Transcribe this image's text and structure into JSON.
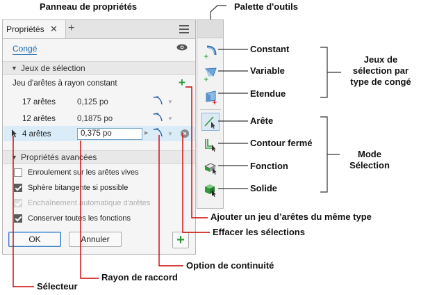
{
  "annotations": {
    "panel_title": "Panneau de propriétés",
    "palette_title": "Palette d'outils",
    "constant": "Constant",
    "variable": "Variable",
    "etendue": "Etendue",
    "jeux_group": "Jeux de sélection par type de congé",
    "arete": "Arête",
    "contour": "Contour fermé",
    "fonction": "Fonction",
    "solide": "Solide",
    "mode_group": "Mode Sélection",
    "add_set": "Ajouter un jeu d’arêtes du même type",
    "clear": "Effacer les sélections",
    "continuity": "Option de continuité",
    "radius": "Rayon de raccord",
    "selector": "Sélecteur"
  },
  "panel": {
    "tab_label": "Propriétés",
    "close_glyph": "✕",
    "add_glyph": "+",
    "feature_name": "Congé",
    "selection_sets": {
      "header": "Jeux de sélection",
      "subheader": "Jeu d'arêtes à rayon constant",
      "rows": [
        {
          "edges": "17 arêtes",
          "radius": "0,125 po"
        },
        {
          "edges": "12 arêtes",
          "radius": "0,1875 po"
        },
        {
          "edges": "4 arêtes",
          "radius": "0,375 po"
        }
      ]
    },
    "advanced": {
      "header": "Propriétés avancées",
      "options": [
        {
          "label": "Enroulement sur les arêtes vives",
          "checked": false,
          "disabled": false
        },
        {
          "label": "Sphère bitangente si possible",
          "checked": true,
          "disabled": false
        },
        {
          "label": "Enchaînement automatique d'arêtes",
          "checked": true,
          "disabled": true
        },
        {
          "label": "Conserver toutes les fonctions",
          "checked": true,
          "disabled": false
        }
      ]
    },
    "ok_label": "OK",
    "cancel_label": "Annuler"
  },
  "colors": {
    "accent": "#2e9a3a",
    "selection": "#d9ecf7",
    "link": "#1a6bb3",
    "callout_line": "#cc0000"
  }
}
